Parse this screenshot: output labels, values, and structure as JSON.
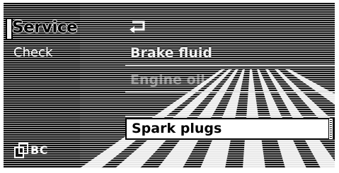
{
  "left_panel": {
    "title": "Service",
    "subtitle": "Check",
    "bc_label": "BC"
  },
  "menu": {
    "items": [
      {
        "label": "Brake fluid",
        "state": "normal"
      },
      {
        "label": "Engine oil",
        "state": "faded"
      },
      {
        "label": "",
        "state": "faded"
      },
      {
        "label": "Spark plugs",
        "state": "selected"
      }
    ]
  },
  "icons": {
    "back": "back-arrow-icon",
    "bc": "bc-icon"
  }
}
